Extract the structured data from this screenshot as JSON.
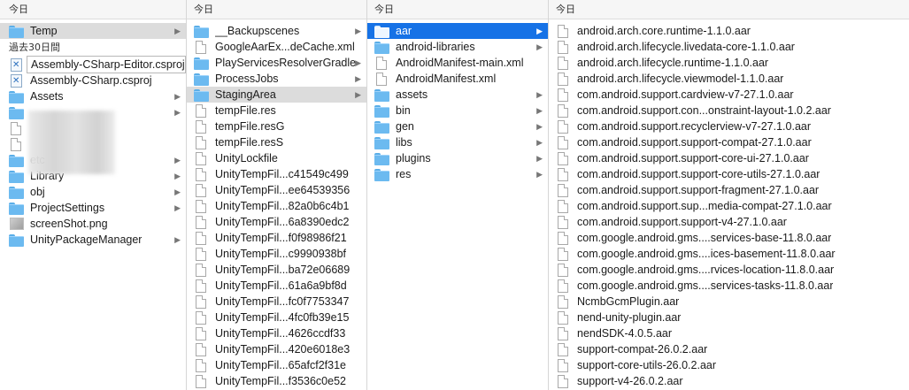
{
  "col1": {
    "header": "今日",
    "items_today": [
      {
        "name": "Temp",
        "type": "folder",
        "chevron": true,
        "selected": "gray"
      }
    ],
    "section2": "過去30日間",
    "items_past": [
      {
        "name": "Assembly-CSharp-Editor.csproj",
        "type": "csproj",
        "chevron": false,
        "selected": "box"
      },
      {
        "name": "Assembly-CSharp.csproj",
        "type": "csproj",
        "chevron": false
      },
      {
        "name": "Assets",
        "type": "folder",
        "chevron": true
      },
      {
        "name": "",
        "type": "folder",
        "chevron": true
      },
      {
        "name": "",
        "type": "doc",
        "chevron": false
      },
      {
        "name": "",
        "type": "doc",
        "chevron": false
      },
      {
        "name": "etc",
        "type": "folder",
        "chevron": true
      },
      {
        "name": "Library",
        "type": "folder",
        "chevron": true
      },
      {
        "name": "obj",
        "type": "folder",
        "chevron": true
      },
      {
        "name": "ProjectSettings",
        "type": "folder",
        "chevron": true
      },
      {
        "name": "screenShot.png",
        "type": "image",
        "chevron": false
      },
      {
        "name": "UnityPackageManager",
        "type": "folder",
        "chevron": true
      }
    ]
  },
  "col2": {
    "header": "今日",
    "items": [
      {
        "name": "__Backupscenes",
        "type": "folder",
        "chevron": true
      },
      {
        "name": "GoogleAarEx...deCache.xml",
        "type": "doc",
        "chevron": false
      },
      {
        "name": "PlayServicesResolverGradle",
        "type": "folder",
        "chevron": true
      },
      {
        "name": "ProcessJobs",
        "type": "folder",
        "chevron": true
      },
      {
        "name": "StagingArea",
        "type": "folder",
        "chevron": true,
        "selected": "gray"
      },
      {
        "name": "tempFile.res",
        "type": "doc",
        "chevron": false
      },
      {
        "name": "tempFile.resG",
        "type": "doc",
        "chevron": false
      },
      {
        "name": "tempFile.resS",
        "type": "doc",
        "chevron": false
      },
      {
        "name": "UnityLockfile",
        "type": "doc",
        "chevron": false
      },
      {
        "name": "UnityTempFil...c41549c499",
        "type": "doc",
        "chevron": false
      },
      {
        "name": "UnityTempFil...ee64539356",
        "type": "doc",
        "chevron": false
      },
      {
        "name": "UnityTempFil...82a0b6c4b1",
        "type": "doc",
        "chevron": false
      },
      {
        "name": "UnityTempFil...6a8390edc2",
        "type": "doc",
        "chevron": false
      },
      {
        "name": "UnityTempFil...f0f98986f21",
        "type": "doc",
        "chevron": false
      },
      {
        "name": "UnityTempFil...c9990938bf",
        "type": "doc",
        "chevron": false
      },
      {
        "name": "UnityTempFil...ba72e06689",
        "type": "doc",
        "chevron": false
      },
      {
        "name": "UnityTempFil...61a6a9bf8d",
        "type": "doc",
        "chevron": false
      },
      {
        "name": "UnityTempFil...fc0f7753347",
        "type": "doc",
        "chevron": false
      },
      {
        "name": "UnityTempFil...4fc0fb39e15",
        "type": "doc",
        "chevron": false
      },
      {
        "name": "UnityTempFil...4626ccdf33",
        "type": "doc",
        "chevron": false
      },
      {
        "name": "UnityTempFil...420e6018e3",
        "type": "doc",
        "chevron": false
      },
      {
        "name": "UnityTempFil...65afcf2f31e",
        "type": "doc",
        "chevron": false
      },
      {
        "name": "UnityTempFil...f3536c0e52",
        "type": "doc",
        "chevron": false
      }
    ]
  },
  "col3": {
    "header": "今日",
    "items": [
      {
        "name": "aar",
        "type": "folder",
        "chevron": true,
        "selected": "blue"
      },
      {
        "name": "android-libraries",
        "type": "folder",
        "chevron": true
      },
      {
        "name": "AndroidManifest-main.xml",
        "type": "doc",
        "chevron": false
      },
      {
        "name": "AndroidManifest.xml",
        "type": "doc",
        "chevron": false
      },
      {
        "name": "assets",
        "type": "folder",
        "chevron": true
      },
      {
        "name": "bin",
        "type": "folder",
        "chevron": true
      },
      {
        "name": "gen",
        "type": "folder",
        "chevron": true
      },
      {
        "name": "libs",
        "type": "folder",
        "chevron": true
      },
      {
        "name": "plugins",
        "type": "folder",
        "chevron": true
      },
      {
        "name": "res",
        "type": "folder",
        "chevron": true
      }
    ]
  },
  "col4": {
    "header": "今日",
    "items": [
      {
        "name": "android.arch.core.runtime-1.1.0.aar",
        "type": "doc"
      },
      {
        "name": "android.arch.lifecycle.livedata-core-1.1.0.aar",
        "type": "doc"
      },
      {
        "name": "android.arch.lifecycle.runtime-1.1.0.aar",
        "type": "doc"
      },
      {
        "name": "android.arch.lifecycle.viewmodel-1.1.0.aar",
        "type": "doc"
      },
      {
        "name": "com.android.support.cardview-v7-27.1.0.aar",
        "type": "doc"
      },
      {
        "name": "com.android.support.con...onstraint-layout-1.0.2.aar",
        "type": "doc"
      },
      {
        "name": "com.android.support.recyclerview-v7-27.1.0.aar",
        "type": "doc"
      },
      {
        "name": "com.android.support.support-compat-27.1.0.aar",
        "type": "doc"
      },
      {
        "name": "com.android.support.support-core-ui-27.1.0.aar",
        "type": "doc"
      },
      {
        "name": "com.android.support.support-core-utils-27.1.0.aar",
        "type": "doc"
      },
      {
        "name": "com.android.support.support-fragment-27.1.0.aar",
        "type": "doc"
      },
      {
        "name": "com.android.support.sup...media-compat-27.1.0.aar",
        "type": "doc"
      },
      {
        "name": "com.android.support.support-v4-27.1.0.aar",
        "type": "doc"
      },
      {
        "name": "com.google.android.gms....services-base-11.8.0.aar",
        "type": "doc"
      },
      {
        "name": "com.google.android.gms....ices-basement-11.8.0.aar",
        "type": "doc"
      },
      {
        "name": "com.google.android.gms....rvices-location-11.8.0.aar",
        "type": "doc"
      },
      {
        "name": "com.google.android.gms....services-tasks-11.8.0.aar",
        "type": "doc"
      },
      {
        "name": "NcmbGcmPlugin.aar",
        "type": "doc"
      },
      {
        "name": "nend-unity-plugin.aar",
        "type": "doc"
      },
      {
        "name": "nendSDK-4.0.5.aar",
        "type": "doc"
      },
      {
        "name": "support-compat-26.0.2.aar",
        "type": "doc"
      },
      {
        "name": "support-core-utils-26.0.2.aar",
        "type": "doc"
      },
      {
        "name": "support-v4-26.0.2.aar",
        "type": "doc"
      }
    ]
  }
}
